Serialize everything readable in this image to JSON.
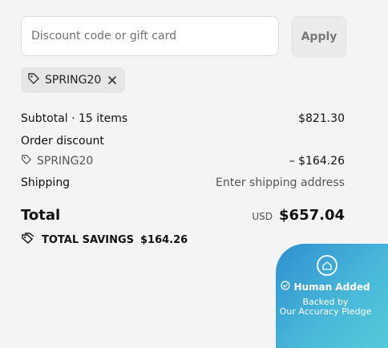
{
  "discount": {
    "placeholder": "Discount code or gift card",
    "apply_label": "Apply",
    "applied_code": "SPRING20"
  },
  "summary": {
    "subtotal_label": "Subtotal · 15 items",
    "subtotal_value": "$821.30",
    "order_discount_label": "Order discount",
    "discount_code": "SPRING20",
    "discount_value": "– $164.26",
    "shipping_label": "Shipping",
    "shipping_value": "Enter shipping address",
    "total_label": "Total",
    "currency": "USD",
    "total_value": "$657.04",
    "savings_label": "TOTAL SAVINGS",
    "savings_value": "$164.26"
  },
  "badge": {
    "title": "Human Added",
    "line1": "Backed by",
    "line2": "Our Accuracy Pledge",
    "gradient_colors": [
      "#2f8fd0",
      "#49b9d9",
      "#55cdd7"
    ]
  },
  "icons": {
    "tag": "tag-icon",
    "close": "close-icon",
    "check": "check-circle-icon",
    "shield": "shield-house-icon"
  }
}
